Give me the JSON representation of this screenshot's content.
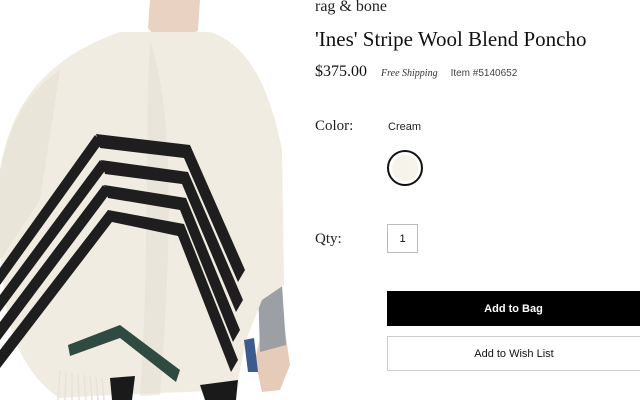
{
  "product": {
    "brand": "rag & bone",
    "title": "'Ines' Stripe Wool Blend Poncho",
    "price": "$375.00",
    "shipping": "Free Shipping",
    "item_number": "Item #5140652",
    "image_icon": "poncho-photo"
  },
  "options": {
    "color_label": "Color:",
    "color_value": "Cream",
    "swatch_color": "#f6f3ea",
    "qty_label": "Qty:",
    "qty_value": "1"
  },
  "actions": {
    "add_to_bag": "Add to Bag",
    "add_to_wishlist": "Add to Wish List"
  }
}
